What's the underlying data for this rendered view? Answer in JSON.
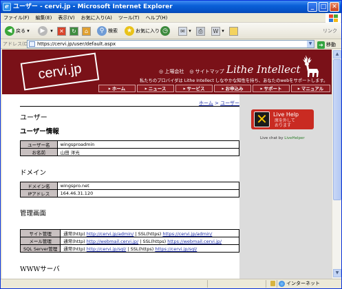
{
  "window": {
    "title": "ユーザー - cervi.jp - Microsoft Internet Explorer"
  },
  "menu": [
    "ファイル(F)",
    "編集(E)",
    "表示(V)",
    "お気に入り(A)",
    "ツール(T)",
    "ヘルプ(H)"
  ],
  "toolbar": {
    "back": "戻る",
    "search": "検索",
    "favorites": "お気に入り",
    "links": "リンク"
  },
  "address": {
    "label": "アドレス(D)",
    "url": "https://cervi.jp/user/default.aspx",
    "go": "移動"
  },
  "header": {
    "logo": "cervi.jp",
    "company_link": "◎ 上場会社",
    "sitemap_link": "◎ サイトマップ",
    "brand": "Lithe Intellect",
    "tagline": "私たちのプロバイダは Lithe Intellect しなやかな知性を持ち、あなたのwebをサポートします。",
    "nav": [
      "ホーム",
      "ニュース",
      "サービス",
      "お申込み",
      "サポート",
      "マニュアル"
    ]
  },
  "breadcrumb": {
    "home": "ホーム",
    "separator": " > ",
    "current": "ユーザー"
  },
  "page": {
    "title": "ユーザー",
    "user_section": "ユーザー情報",
    "user_rows": [
      {
        "key": "ユーザー名",
        "value": "wingsproadmin"
      },
      {
        "key": "お名前",
        "value": "山田 洋光"
      }
    ],
    "domain_section": "ドメイン",
    "domain_rows": [
      {
        "key": "ドメイン名",
        "value": "wingspro.net"
      },
      {
        "key": "IPアドレス",
        "value": "164.46.31.120"
      }
    ],
    "admin_section": "管理画面",
    "admin_rows": [
      {
        "key": "サイト管理",
        "prefix": "通常(http)",
        "link1": "http://cervi.jp/admin/",
        "mid": " | SSL(https) ",
        "link2": "https://cervi.jp/admin/"
      },
      {
        "key": "メール管理",
        "prefix": "通常(http)",
        "link1": "http://webmail.cervi.jp/",
        "mid": " | SSL(https) ",
        "link2": "https://webmail.cervi.jp/"
      },
      {
        "key": "SQL Server管理",
        "prefix": "通常(http)",
        "link1": "http://cervi.jp/sql/",
        "mid": " | SSL(https) ",
        "link2": "https://cervi.jp/sql/"
      }
    ],
    "www_section": "WWWサーバ"
  },
  "sidebar": {
    "livehelp_title": "Live Help",
    "livehelp_status": "席を外して\nおります",
    "livechat_prefix": "Live chat by ",
    "livechat_brand": "LiveHelper"
  },
  "status": {
    "zone": "インターネット"
  },
  "colors": {
    "header": "#7a1118",
    "nav": "#8d1b21",
    "sidebar": "#dcdcdc",
    "table_key": "#c8c0c0"
  }
}
